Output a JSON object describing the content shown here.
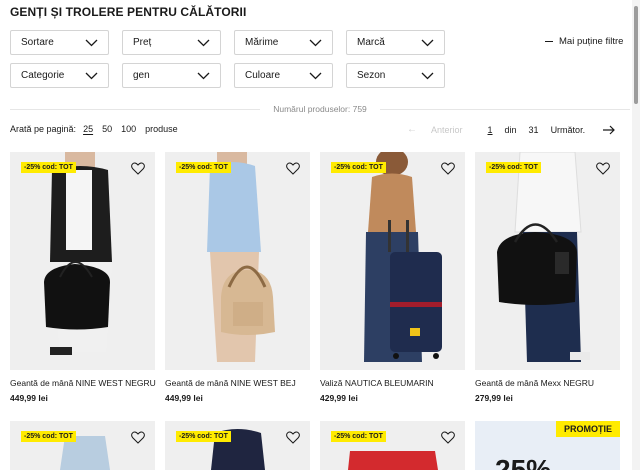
{
  "page": {
    "title": "GENȚI ȘI TROLERE PENTRU CĂLĂTORII"
  },
  "filters": [
    {
      "label": "Sortare"
    },
    {
      "label": "Preț"
    },
    {
      "label": "Mărime"
    },
    {
      "label": "Marcă"
    },
    {
      "label": "Categorie"
    },
    {
      "label": "gen"
    },
    {
      "label": "Culoare"
    },
    {
      "label": "Sezon"
    }
  ],
  "less_filters_label": "Mai puține filtre",
  "product_count": "Numărul produselor:  759",
  "per_page": {
    "label": "Arată pe pagină:",
    "options": [
      "25",
      "50",
      "100"
    ],
    "selected": "25",
    "suffix": "produse"
  },
  "pagination": {
    "prev": "Anterior",
    "current": "1",
    "of": "din",
    "total": "31",
    "next": "Următor."
  },
  "products": [
    {
      "badge": "-25% cod: TOT",
      "name": "Geantă de mână NINE WEST NEGRU",
      "price": "449,99 lei"
    },
    {
      "badge": "-25% cod: TOT",
      "name": "Geantă de mână NINE WEST BEJ",
      "price": "449,99 lei"
    },
    {
      "badge": "-25% cod: TOT",
      "name": "Valiză NAUTICA BLEUMARIN",
      "price": "429,99 lei"
    },
    {
      "badge": "-25% cod: TOT",
      "name": "Geantă de mână Mexx NEGRU",
      "price": "279,99 lei"
    }
  ],
  "products_row2": [
    {
      "badge": "-25% cod: TOT"
    },
    {
      "badge": "-25% cod: TOT"
    },
    {
      "badge": "-25% cod: TOT"
    }
  ],
  "promo": {
    "tag": "PROMOȚIE",
    "text": "25%"
  },
  "colors": {
    "badge": "#ffeb00",
    "text": "#1a1a1a",
    "border": "#d4d4d4"
  }
}
